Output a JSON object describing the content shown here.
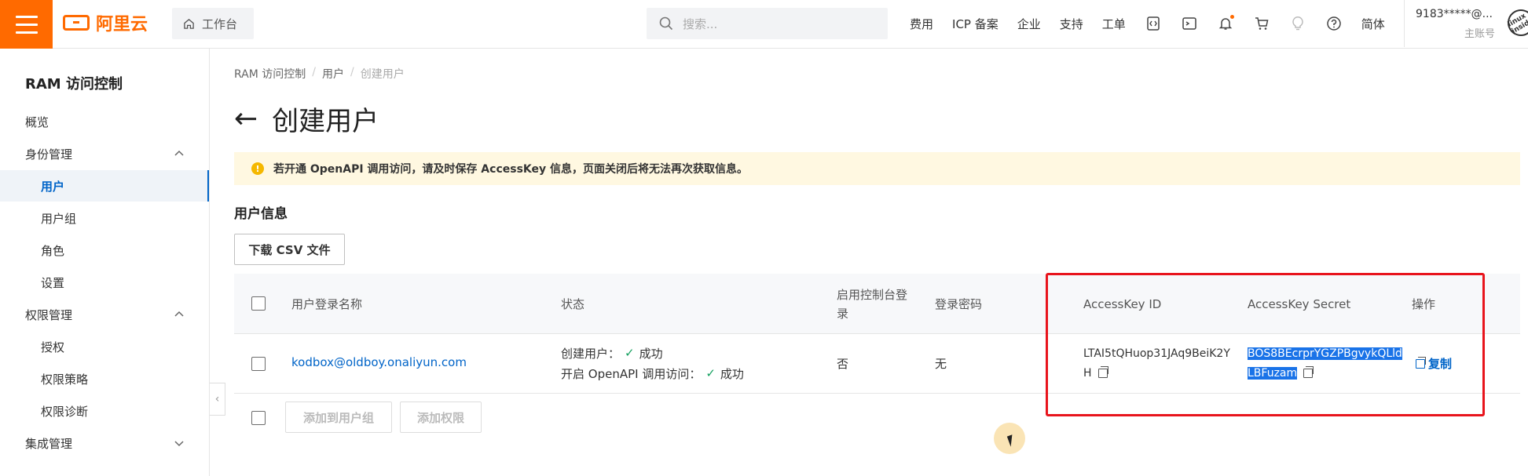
{
  "topbar": {
    "logo_text": "阿里云",
    "workbench_label": "工作台",
    "search_placeholder": "搜索...",
    "nav": [
      "费用",
      "ICP 备案",
      "企业",
      "支持",
      "工单"
    ],
    "icons": [
      "code-icon",
      "terminal-icon",
      "bell-icon",
      "cart-icon",
      "bulb-icon",
      "help-icon"
    ],
    "lang": "简体",
    "account_name": "9183*****@...",
    "account_role": "主账号",
    "avatar_text": "linux inside"
  },
  "sidebar": {
    "title": "RAM 访问控制",
    "items": [
      {
        "label": "概览",
        "level": 1
      },
      {
        "label": "身份管理",
        "level": 1,
        "chevron": "up"
      },
      {
        "label": "用户",
        "level": 2,
        "active": true
      },
      {
        "label": "用户组",
        "level": 2
      },
      {
        "label": "角色",
        "level": 2
      },
      {
        "label": "设置",
        "level": 2
      },
      {
        "label": "权限管理",
        "level": 1,
        "chevron": "up"
      },
      {
        "label": "授权",
        "level": 2
      },
      {
        "label": "权限策略",
        "level": 2
      },
      {
        "label": "权限诊断",
        "level": 2
      },
      {
        "label": "集成管理",
        "level": 1,
        "chevron": "down"
      }
    ]
  },
  "main": {
    "breadcrumb": [
      "RAM 访问控制",
      "用户",
      "创建用户"
    ],
    "title": "创建用户",
    "notice": "若开通 OpenAPI 调用访问，请及时保存 AccessKey 信息，页面关闭后将无法再次获取信息。",
    "section_title": "用户信息",
    "download_csv": "下载 CSV 文件",
    "table": {
      "headers": {
        "login_name": "用户登录名称",
        "status": "状态",
        "console_login_1": "启用控制台登",
        "console_login_2": "录",
        "password": "登录密码",
        "ak_id": "AccessKey ID",
        "ak_secret": "AccessKey Secret",
        "ops": "操作"
      },
      "row": {
        "login_name": "kodbox@oldboy.onaliyun.com",
        "status_create_label": "创建用户：",
        "status_create_value": "成功",
        "status_api_label": "开启 OpenAPI 调用访问：",
        "status_api_value": "成功",
        "console_login": "否",
        "password": "无",
        "ak_id_1": "LTAI5tQHuop31JAq9BeiK2Y",
        "ak_id_2": "H",
        "ak_secret_1": "BOS8BEcrprYGZPBgvykQLld",
        "ak_secret_2": "LBFuzam",
        "copy": "复制"
      }
    },
    "add_to_group": "添加到用户组",
    "add_permission": "添加权限"
  }
}
